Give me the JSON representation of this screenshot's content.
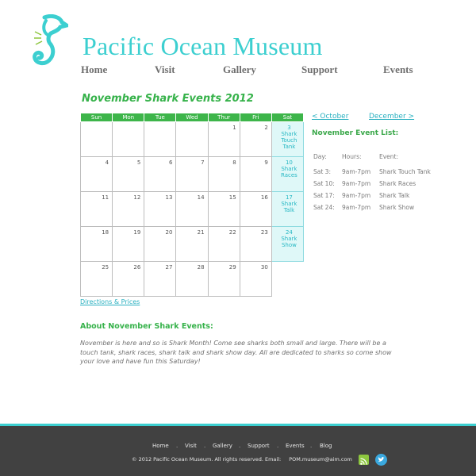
{
  "header": {
    "logo_text": "Pacific Ocean Museum",
    "nav": [
      "Home",
      "Visit",
      "Gallery",
      "Support",
      "Events"
    ]
  },
  "calendar": {
    "title": "November Shark Events 2012",
    "weekdays": [
      "Sun",
      "Mon",
      "Tue",
      "Wed",
      "Thur",
      "Fri",
      "Sat"
    ],
    "weeks": [
      [
        {
          "day": ""
        },
        {
          "day": ""
        },
        {
          "day": ""
        },
        {
          "day": ""
        },
        {
          "day": "1"
        },
        {
          "day": "2"
        },
        {
          "day": "3",
          "event": "Shark Touch Tank"
        }
      ],
      [
        {
          "day": "4"
        },
        {
          "day": "5"
        },
        {
          "day": "6"
        },
        {
          "day": "7"
        },
        {
          "day": "8"
        },
        {
          "day": "9"
        },
        {
          "day": "10",
          "event": "Shark Races"
        }
      ],
      [
        {
          "day": "11"
        },
        {
          "day": "12"
        },
        {
          "day": "13"
        },
        {
          "day": "14"
        },
        {
          "day": "15"
        },
        {
          "day": "16"
        },
        {
          "day": "17",
          "event": "Shark Talk"
        }
      ],
      [
        {
          "day": "18"
        },
        {
          "day": "19"
        },
        {
          "day": "20"
        },
        {
          "day": "21"
        },
        {
          "day": "22"
        },
        {
          "day": "23"
        },
        {
          "day": "24",
          "event": "Shark Show"
        }
      ],
      [
        {
          "day": "25"
        },
        {
          "day": "26"
        },
        {
          "day": "27"
        },
        {
          "day": "28"
        },
        {
          "day": "29"
        },
        {
          "day": "30"
        },
        {
          "day": "",
          "blank": true
        }
      ]
    ],
    "directions_link": "Directions & Prices"
  },
  "sidebar": {
    "prev_link": "< October",
    "next_link": "December >",
    "list_title": "November Event List:",
    "headers": [
      "Day:",
      "Hours:",
      "Event:"
    ],
    "events": [
      {
        "day": "Sat 3:",
        "hours": "9am-7pm",
        "event": "Shark Touch Tank"
      },
      {
        "day": "Sat 10:",
        "hours": "9am-7pm",
        "event": "Shark Races"
      },
      {
        "day": "Sat 17:",
        "hours": "9am-7pm",
        "event": "Shark Talk"
      },
      {
        "day": "Sat 24:",
        "hours": "9am-7pm",
        "event": "Shark Show"
      }
    ]
  },
  "about": {
    "title": "About November Shark Events:",
    "text": "November is here and so is Shark Month! Come see sharks both small and large. There will be a touch tank, shark races, shark talk and shark show day. All are dedicated to sharks so come show your love and have fun this Saturday!"
  },
  "footer": {
    "nav": [
      "Home",
      "Visit",
      "Gallery",
      "Support",
      "Events",
      "Blog"
    ],
    "separator": ".",
    "copyright": "© 2012 Pacific Ocean Museum. All rights reserved. Email:",
    "email": "POM.museum@aim.com",
    "icons": [
      "rss-icon",
      "twitter-icon"
    ]
  },
  "colors": {
    "brand_teal": "#3ccfd0",
    "green": "#3db54a",
    "footer_bg": "#414141",
    "event_bg": "#dff8f8"
  }
}
